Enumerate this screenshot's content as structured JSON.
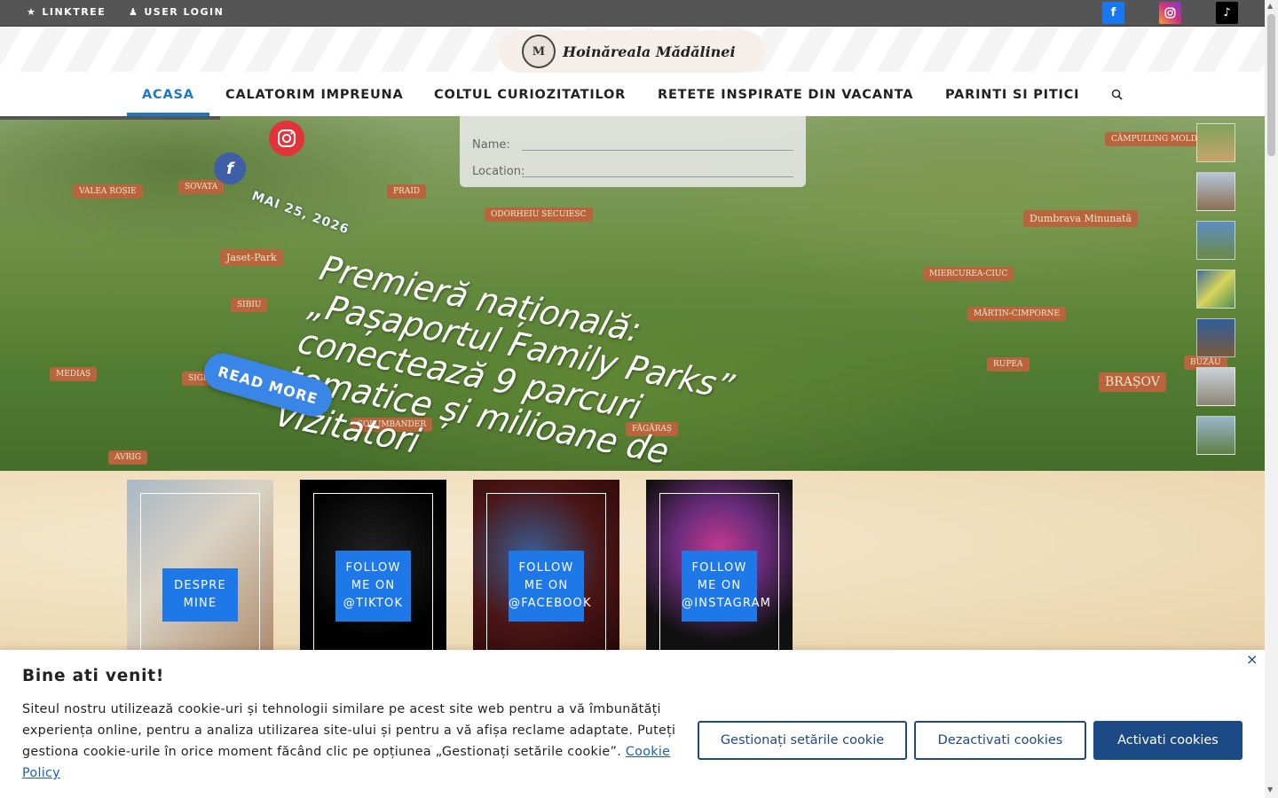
{
  "topbar": {
    "linktree_label": "LINKTREE",
    "login_label": "USER LOGIN",
    "colors": {
      "facebook": "#1877f2",
      "instagram": "#c13584",
      "tiktok": "#000000"
    }
  },
  "header": {
    "logo_text": "Hoinăreala Mădălinei",
    "logo_mark": "M",
    "nav": [
      {
        "label": "ACASA",
        "active": true
      },
      {
        "label": "CALATORIM IMPREUNA"
      },
      {
        "label": "COLTUL CURIOZITATILOR"
      },
      {
        "label": "RETETE INSPIRATE DIN VACANTA"
      },
      {
        "label": "PARINTI SI PITICI"
      }
    ],
    "accent": "#1e78c8"
  },
  "hero": {
    "date": "MAI 25, 2026",
    "title": "Premieră națională: „Pașaportul Family Parks” conectează 9 parcuri tematice și milioane de vizitatori",
    "read_more": "READ MORE",
    "paper_fields": {
      "name": "Name:",
      "location": "Location:"
    },
    "map_labels": [
      "Dumbrava Minunată",
      "BRAȘOV",
      "Jaset-Park",
      "MIERCUREA-CIUC",
      "ODORHEIU SECUIESC",
      "AVRIG",
      "FĂGĂRAȘ",
      "CÂMPULUNG MOLD.",
      "BUZĂU",
      "MEDIAȘ",
      "SIGHIȘOARA",
      "SIBIU",
      "PRAID",
      "SOVATA",
      "MĂRTIN-CIMPORNE",
      "RUPEA",
      "COLUMBANDER",
      "VALEA ROȘIE"
    ]
  },
  "cards": [
    {
      "label": "DESPRE MINE"
    },
    {
      "label": "FOLLOW ME ON @TIKTOK"
    },
    {
      "label": "FOLLOW ME ON @FACEBOOK"
    },
    {
      "label": "FOLLOW ME ON @INSTAGRAM"
    }
  ],
  "cookie": {
    "title": "Bine ati venit!",
    "text": "Siteul  nostru utilizează cookie-uri și tehnologii similare pe acest site web pentru a vă îmbunătăți experiența online, pentru a analiza utilizarea site-ului și pentru a vă afișa reclame adaptate. Puteți gestiona cookie-urile în orice moment făcând clic pe opțiunea „Gestionați setările cookie”. ",
    "policy_link": "Cookie Policy",
    "btn_manage": "Gestionați setările cookie",
    "btn_disable": "Dezactivati cookies",
    "btn_enable": "Activati cookies",
    "close": "×",
    "accent": "#1b4a87"
  }
}
